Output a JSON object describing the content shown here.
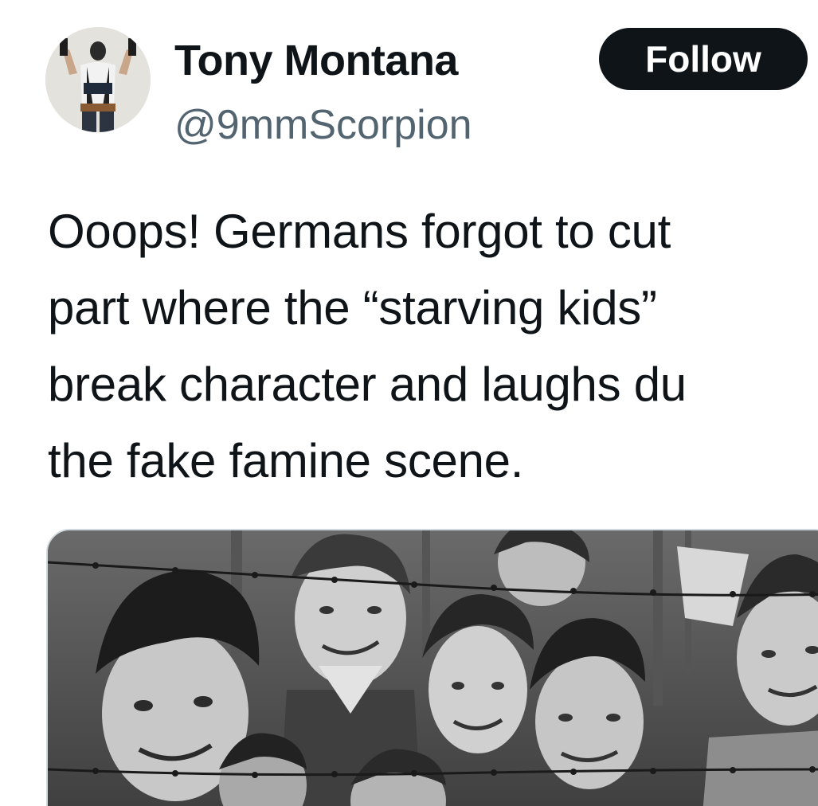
{
  "tweet": {
    "author": {
      "display_name": "Tony Montana",
      "handle": "@9mmScorpion",
      "avatar_icon": "profile-photo"
    },
    "follow_label": "Follow",
    "text_lines": [
      "Ooops! Germans forgot to cut",
      "part where the “starving kids”",
      "break character and laughs du",
      "the fake famine scene."
    ],
    "media": {
      "kind": "photo",
      "tone": "black-and-white"
    }
  },
  "colors": {
    "text_primary": "#0f1419",
    "text_secondary": "#536471",
    "button_bg": "#0f1419",
    "button_text": "#ffffff",
    "card_border": "#cfd9de"
  }
}
